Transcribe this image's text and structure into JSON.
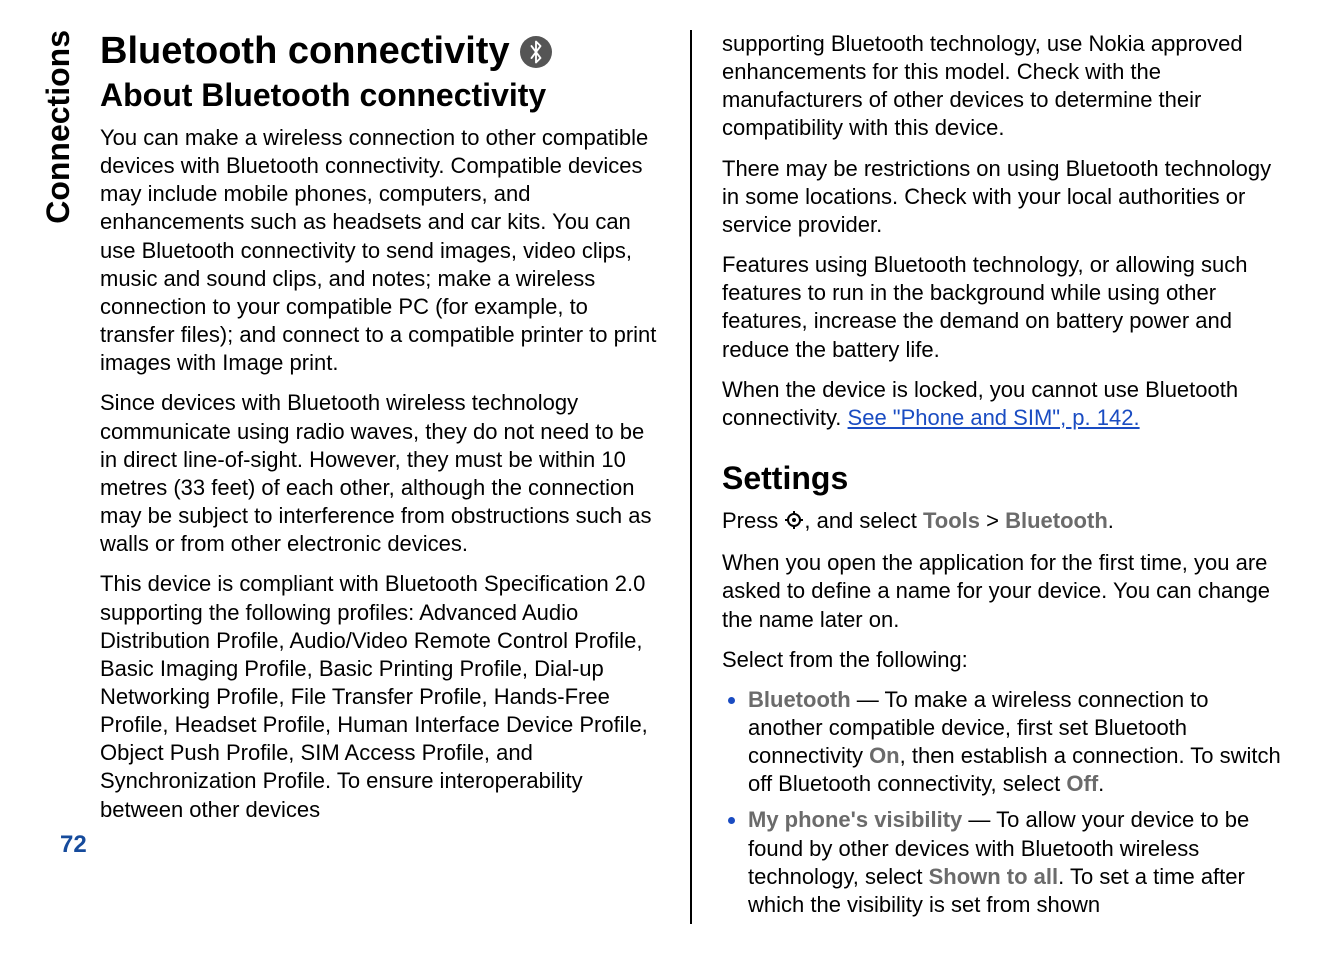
{
  "section_label": "Connections",
  "page_number": "72",
  "left": {
    "h1": "Bluetooth connectivity",
    "h2": "About Bluetooth connectivity",
    "p1": "You can make a wireless connection to other compatible devices with Bluetooth connectivity. Compatible devices may include mobile phones, computers, and enhancements such as headsets and car kits. You can use Bluetooth connectivity to send images, video clips, music and sound clips, and notes; make a wireless connection to your compatible PC (for example, to transfer files); and connect to a compatible printer to print images with Image print.",
    "p2": "Since devices with Bluetooth wireless technology communicate using radio waves, they do not need to be in direct line-of-sight. However, they must be within 10 metres (33 feet) of each other, although the connection may be subject to interference from obstructions such as walls or from other electronic devices.",
    "p3": "This device is compliant with Bluetooth Specification 2.0 supporting the following profiles: Advanced Audio Distribution Profile, Audio/Video Remote Control Profile, Basic Imaging Profile, Basic Printing Profile, Dial-up Networking Profile, File Transfer Profile, Hands-Free Profile, Headset Profile, Human Interface Device Profile, Object Push Profile, SIM Access Profile, and Synchronization Profile. To ensure interoperability between other devices"
  },
  "right": {
    "p1": "supporting Bluetooth technology, use Nokia approved enhancements for this model. Check with the manufacturers of other devices to determine their compatibility with this device.",
    "p2": "There may be restrictions on using Bluetooth technology in some locations. Check with your local authorities or service provider.",
    "p3": "Features using Bluetooth technology, or allowing such features to run in the background while using other features, increase the demand on battery power and reduce the battery life.",
    "p4_pre": "When the device is locked, you cannot use Bluetooth connectivity. ",
    "p4_link": "See \"Phone and SIM\", p. 142.",
    "h2_settings": "Settings",
    "p5_pre": "Press ",
    "p5_mid": ", and select ",
    "p5_tools": "Tools",
    "p5_gt": " > ",
    "p5_bt": "Bluetooth",
    "p5_end": ".",
    "p6": "When you open the application for the first time, you are asked to define a name for your device. You can change the name later on.",
    "p7": "Select from the following:",
    "li1_label": "Bluetooth",
    "li1_a": " — To make a wireless connection to another compatible device, first set Bluetooth connectivity ",
    "li1_on": "On",
    "li1_b": ", then establish a connection. To switch off Bluetooth connectivity, select ",
    "li1_off": "Off",
    "li1_c": ".",
    "li2_label": "My phone's visibility",
    "li2_a": " — To allow your device to be found by other devices with Bluetooth wireless technology, select ",
    "li2_shown": "Shown to all",
    "li2_b": ". To set a time after which the visibility is set from shown"
  }
}
